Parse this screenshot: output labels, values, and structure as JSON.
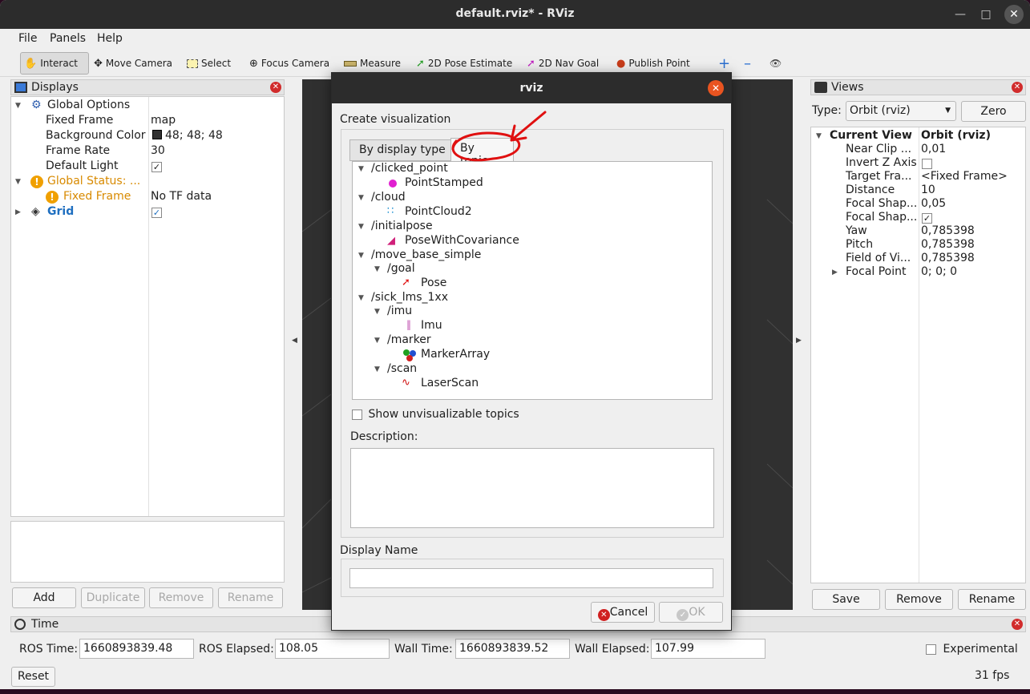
{
  "window": {
    "title": "default.rviz* - RViz"
  },
  "menu": {
    "file": "File",
    "panels": "Panels",
    "help": "Help"
  },
  "toolbar": {
    "interact": "Interact",
    "move_camera": "Move Camera",
    "select": "Select",
    "focus_camera": "Focus Camera",
    "measure": "Measure",
    "pose_estimate": "2D Pose Estimate",
    "nav_goal": "2D Nav Goal",
    "publish_point": "Publish Point"
  },
  "displays": {
    "title": "Displays",
    "rows": [
      {
        "label": "Global Options",
        "value": ""
      },
      {
        "label": "Fixed Frame",
        "value": "map"
      },
      {
        "label": "Background Color",
        "value": "48; 48; 48"
      },
      {
        "label": "Frame Rate",
        "value": "30"
      },
      {
        "label": "Default Light",
        "value": "✓"
      },
      {
        "label": "Global Status: ...",
        "value": ""
      },
      {
        "label": "Fixed Frame",
        "value": "No TF data"
      },
      {
        "label": "Grid",
        "value": "✓"
      }
    ],
    "buttons": {
      "add": "Add",
      "duplicate": "Duplicate",
      "remove": "Remove",
      "rename": "Rename"
    }
  },
  "views": {
    "title": "Views",
    "type_label": "Type:",
    "type_value": "Orbit (rviz)",
    "zero": "Zero",
    "rows": [
      {
        "label": "Current View",
        "value": "Orbit (rviz)"
      },
      {
        "label": "Near Clip ...",
        "value": "0,01"
      },
      {
        "label": "Invert Z Axis",
        "value": ""
      },
      {
        "label": "Target Fra...",
        "value": "<Fixed Frame>"
      },
      {
        "label": "Distance",
        "value": "10"
      },
      {
        "label": "Focal Shap...",
        "value": "0,05"
      },
      {
        "label": "Focal Shap...",
        "value": "✓"
      },
      {
        "label": "Yaw",
        "value": "0,785398"
      },
      {
        "label": "Pitch",
        "value": "0,785398"
      },
      {
        "label": "Field of Vi...",
        "value": "0,785398"
      },
      {
        "label": "Focal Point",
        "value": "0; 0; 0"
      }
    ],
    "buttons": {
      "save": "Save",
      "remove": "Remove",
      "rename": "Rename"
    }
  },
  "time": {
    "title": "Time",
    "ros_time_label": "ROS Time:",
    "ros_time": "1660893839.48",
    "ros_elapsed_label": "ROS Elapsed:",
    "ros_elapsed": "108.05",
    "wall_time_label": "Wall Time:",
    "wall_time": "1660893839.52",
    "wall_elapsed_label": "Wall Elapsed:",
    "wall_elapsed": "107.99",
    "experimental": "Experimental",
    "reset": "Reset",
    "fps": "31 fps"
  },
  "dialog": {
    "title": "rviz",
    "heading": "Create visualization",
    "tab_display_type": "By display type",
    "tab_topic": "By topic",
    "topics": [
      {
        "label": "/clicked_point"
      },
      {
        "label": "PointStamped"
      },
      {
        "label": "/cloud"
      },
      {
        "label": "PointCloud2"
      },
      {
        "label": "/initialpose"
      },
      {
        "label": "PoseWithCovariance"
      },
      {
        "label": "/move_base_simple"
      },
      {
        "label": "/goal"
      },
      {
        "label": "Pose"
      },
      {
        "label": "/sick_lms_1xx"
      },
      {
        "label": "/imu"
      },
      {
        "label": "Imu"
      },
      {
        "label": "/marker"
      },
      {
        "label": "MarkerArray"
      },
      {
        "label": "/scan"
      },
      {
        "label": "LaserScan"
      }
    ],
    "show_unvisualizable": "Show unvisualizable topics",
    "description_label": "Description:",
    "display_name_label": "Display Name",
    "display_name_value": "",
    "cancel": "Cancel",
    "ok": "OK"
  },
  "colors": {
    "accent": "#e95420",
    "warning": "#d88a00",
    "grid_blue": "#1f6fc0",
    "annotation": "#e01010"
  }
}
